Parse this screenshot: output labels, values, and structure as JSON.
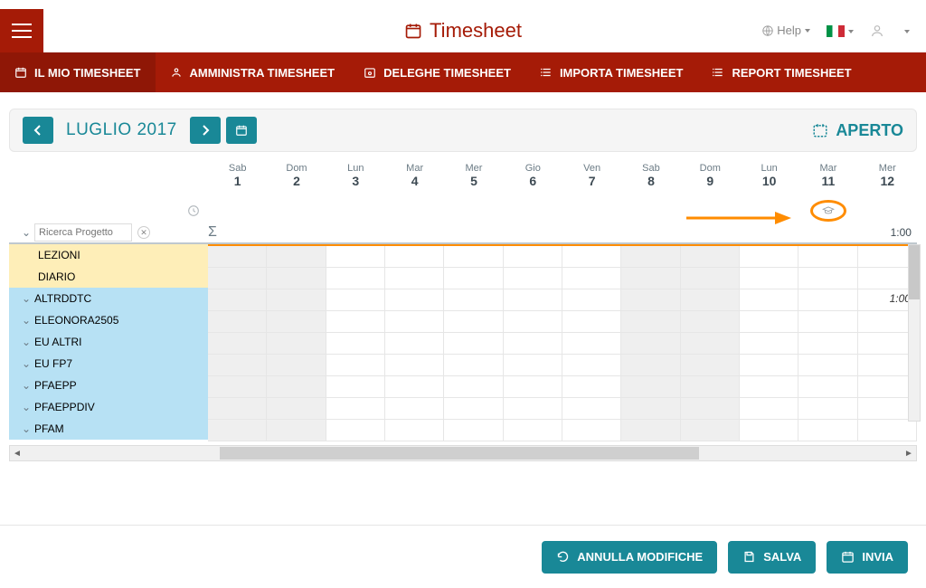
{
  "header": {
    "title": "Timesheet",
    "help_label": "Help",
    "flag_alt": "italian-flag"
  },
  "tabs": [
    {
      "label": "IL MIO TIMESHEET",
      "active": true,
      "icon": "calendar-icon"
    },
    {
      "label": "AMMINISTRA TIMESHEET",
      "active": false,
      "icon": "admin-icon"
    },
    {
      "label": "DELEGHE TIMESHEET",
      "active": false,
      "icon": "delegate-icon"
    },
    {
      "label": "IMPORTA TIMESHEET",
      "active": false,
      "icon": "list-icon"
    },
    {
      "label": "REPORT TIMESHEET",
      "active": false,
      "icon": "list-icon"
    }
  ],
  "datebar": {
    "month_label": "LUGLIO 2017",
    "status": "APERTO"
  },
  "days": [
    {
      "dow": "Sab",
      "num": "1"
    },
    {
      "dow": "Dom",
      "num": "2"
    },
    {
      "dow": "Lun",
      "num": "3"
    },
    {
      "dow": "Mar",
      "num": "4"
    },
    {
      "dow": "Mer",
      "num": "5"
    },
    {
      "dow": "Gio",
      "num": "6"
    },
    {
      "dow": "Ven",
      "num": "7"
    },
    {
      "dow": "Sab",
      "num": "8"
    },
    {
      "dow": "Dom",
      "num": "9"
    },
    {
      "dow": "Lun",
      "num": "10"
    },
    {
      "dow": "Mar",
      "num": "11"
    },
    {
      "dow": "Mer",
      "num": "12"
    }
  ],
  "search": {
    "placeholder": "Ricerca Progetto"
  },
  "totals": {
    "col12": "1:00"
  },
  "projects": {
    "fixed": [
      {
        "label": "LEZIONI"
      },
      {
        "label": "DIARIO"
      }
    ],
    "list": [
      {
        "label": "ALTRDDTC"
      },
      {
        "label": "ELEONORA2505"
      },
      {
        "label": "EU ALTRI"
      },
      {
        "label": "EU FP7"
      },
      {
        "label": "PFAEPP"
      },
      {
        "label": "PFAEPPDIV"
      },
      {
        "label": "PFAM"
      }
    ]
  },
  "cells": {
    "altrddtc_col12": "1:00"
  },
  "footer": {
    "undo": "ANNULLA MODIFICHE",
    "save": "SALVA",
    "send": "INVIA"
  },
  "colors": {
    "brand": "#a51b07",
    "teal": "#198897",
    "highlight": "#ff8c00"
  }
}
